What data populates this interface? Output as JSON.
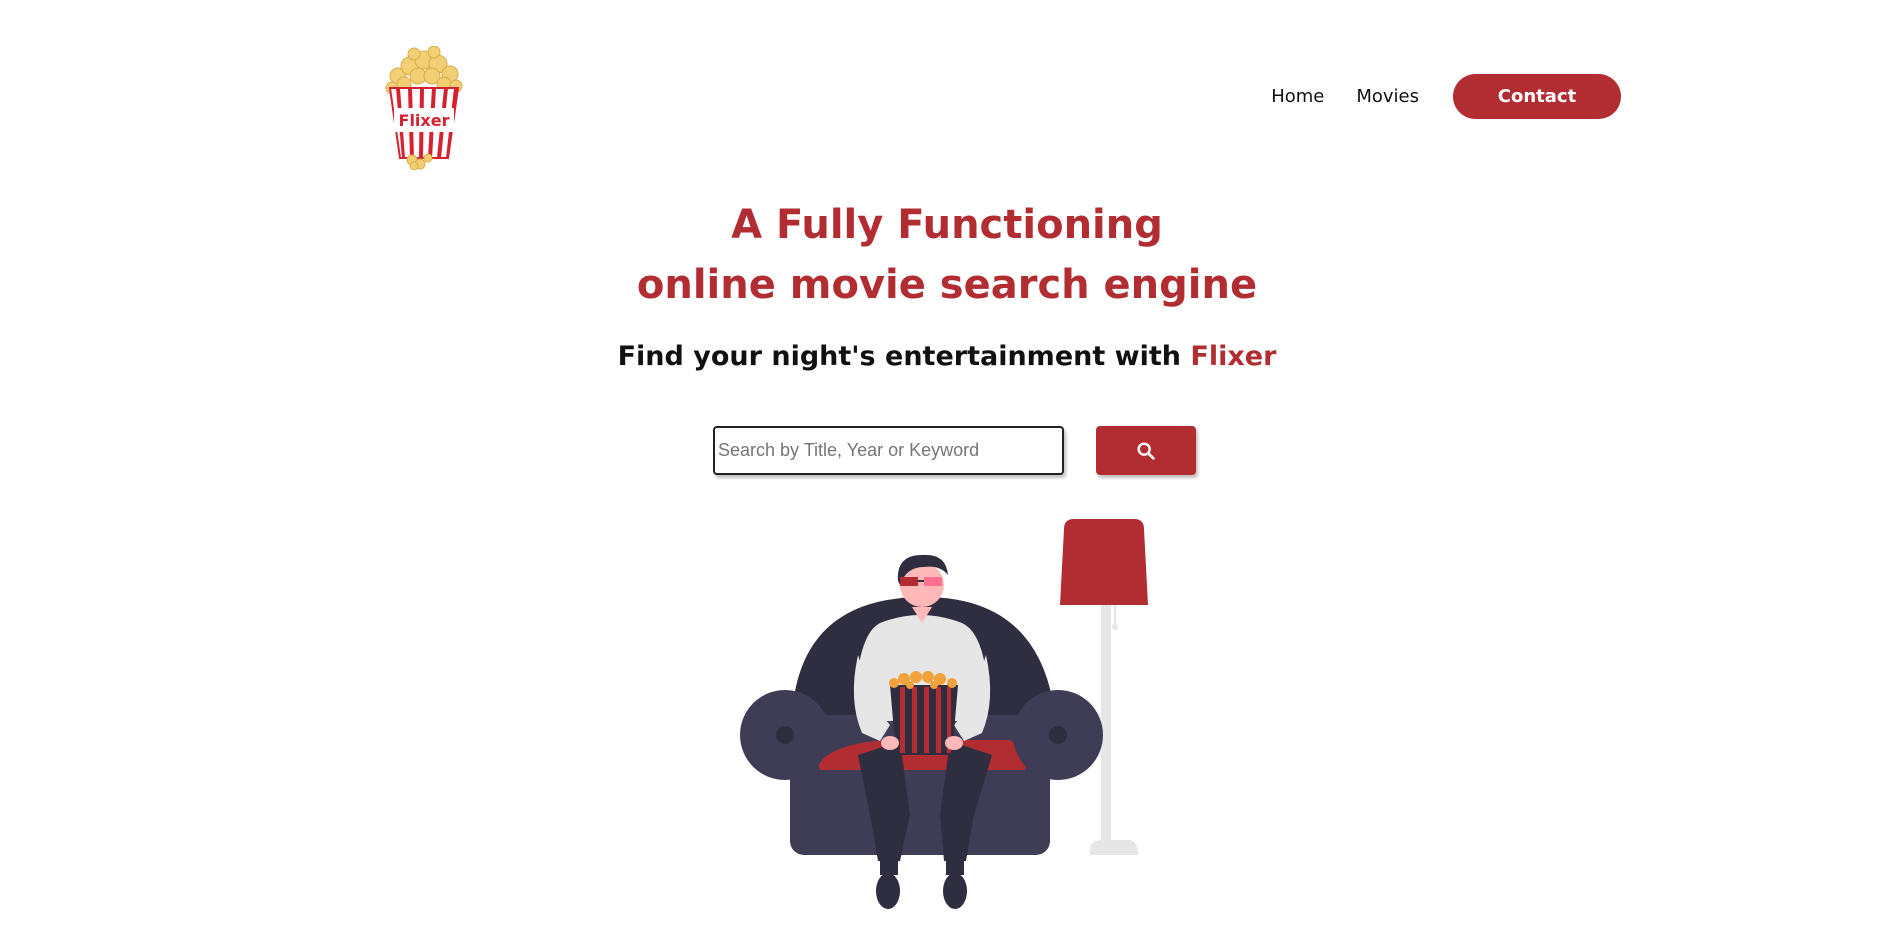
{
  "header": {
    "logo_text": "Flixer",
    "logo_icon": "popcorn-bucket-icon",
    "nav": {
      "home_label": "Home",
      "movies_label": "Movies",
      "contact_label": "Contact"
    }
  },
  "hero": {
    "title_line1": "A Fully Functioning",
    "title_line2": "online movie search engine",
    "tagline_prefix": "Find your night's entertainment with ",
    "tagline_brand": "Flixer"
  },
  "search": {
    "placeholder": "Search by Title, Year or Keyword",
    "value": "",
    "button_icon": "search-icon"
  },
  "illustration": {
    "subject": "person-on-armchair-with-popcorn-illustration"
  },
  "colors": {
    "brand_red": "#b22d32",
    "text_dark": "#111111",
    "couch": "#3f3d56",
    "lamp_pole": "#e6e6e6"
  }
}
